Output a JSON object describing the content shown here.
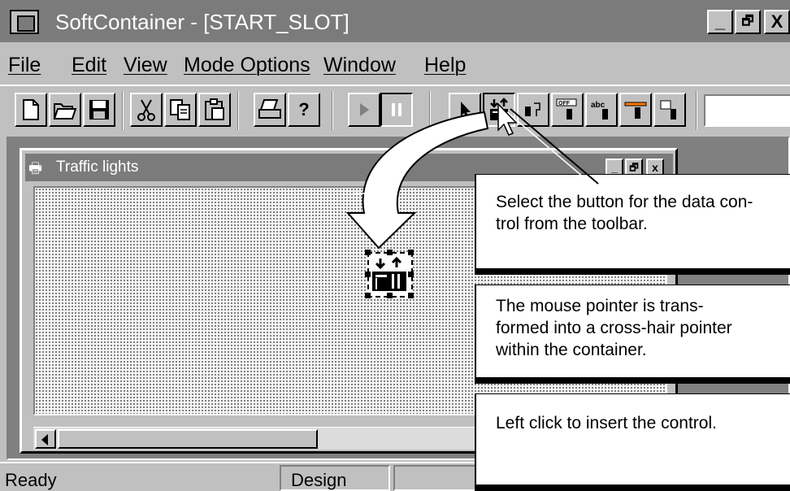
{
  "window": {
    "title": "SoftContainer - [START_SLOT]",
    "minimize": "_",
    "restore": "🗗",
    "close": "X"
  },
  "menu": [
    "File",
    "Edit",
    "View",
    "Mode Options",
    "Window",
    "Help"
  ],
  "toolbar": {
    "buttons": [
      "new-document",
      "open-folder",
      "save-disk",
      "cut-scissors",
      "copy",
      "paste",
      "print",
      "help",
      "run",
      "pause",
      "pointer",
      "data-control",
      "control-2",
      "off-switch",
      "text-control",
      "slider-control",
      "keypad-control"
    ],
    "help_glyph": "?",
    "off_label": "OFF",
    "abc_label": "abc"
  },
  "child_window": {
    "title": "Traffic lights",
    "minimize": "_",
    "restore": "🗗",
    "close": "x"
  },
  "status": {
    "text": "Ready",
    "mode": "Design"
  },
  "callouts": [
    {
      "line1": "Select the button for the data con-",
      "line2": "trol from the toolbar."
    },
    {
      "line1": "The mouse pointer is trans-",
      "line2": "formed into a cross-hair pointer",
      "line3": "within the container."
    },
    {
      "line1": "Left click to insert the control."
    }
  ]
}
